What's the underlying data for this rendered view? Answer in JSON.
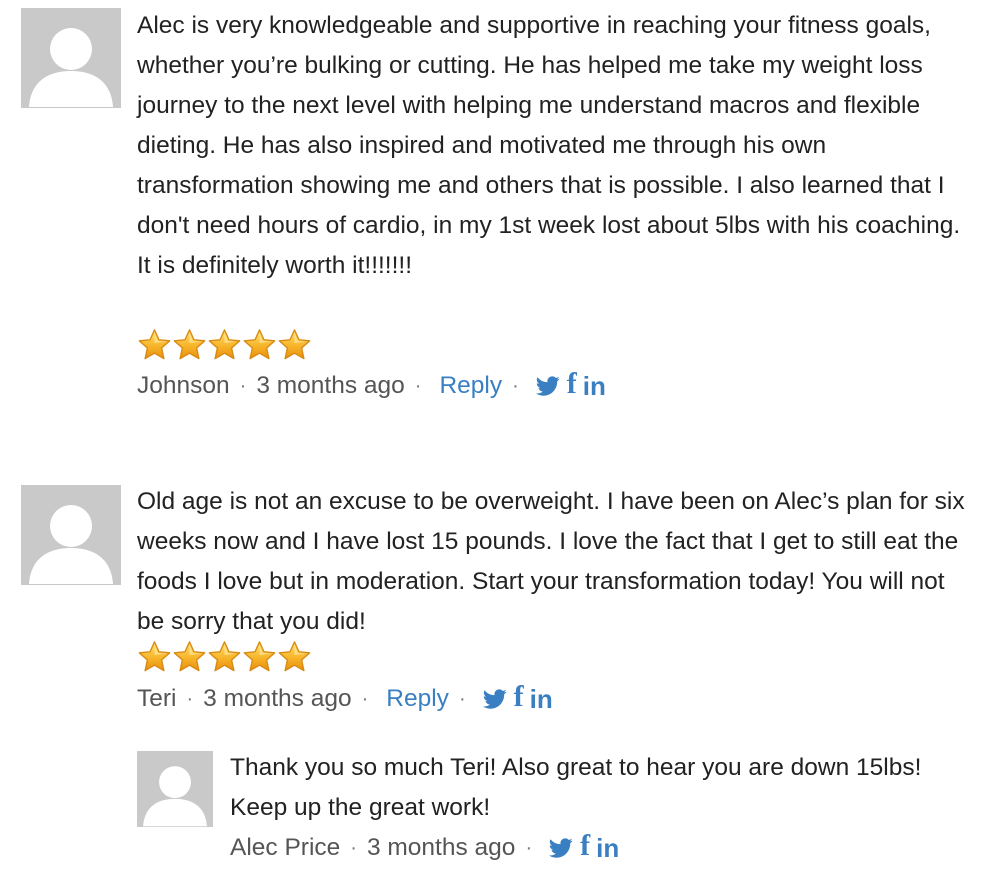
{
  "comments": [
    {
      "text": "Alec is very knowledgeable and supportive in reaching your fitness goals, whether you’re bulking or cutting. He has helped me take my weight loss journey to the next level with helping me understand macros and flexible dieting. He has also inspired and motivated me through his own transformation showing me and others that is possible. I also learned that I don't need hours of cardio, in my 1st week lost about 5lbs with his coaching. It is definitely worth it!!!!!!!",
      "rating": 5,
      "author": "Johnson",
      "time": "3 months ago",
      "reply_label": "Reply",
      "separator": "·"
    },
    {
      "text": "Old age is not an excuse to be overweight. I have been on Alec’s plan for six weeks now and I have lost 15 pounds. I love the fact that I get to still eat the foods I love but in moderation. Start your transformation today! You will not be sorry that you did!",
      "rating": 5,
      "author": "Teri",
      "time": "3 months ago",
      "reply_label": "Reply",
      "separator": "·"
    },
    {
      "text": "Thank you so much Teri! Also great to hear you are down 15lbs! Keep up the great work!",
      "author": "Alec Price",
      "time": "3 months ago",
      "separator": "·"
    }
  ],
  "social": {
    "twitter_icon": "twitter-icon",
    "facebook_glyph": "f",
    "linkedin_glyph": "in"
  },
  "colors": {
    "link": "#3a7fc1",
    "avatar_bg": "#c9c9c9",
    "star": "#f5b82e"
  }
}
